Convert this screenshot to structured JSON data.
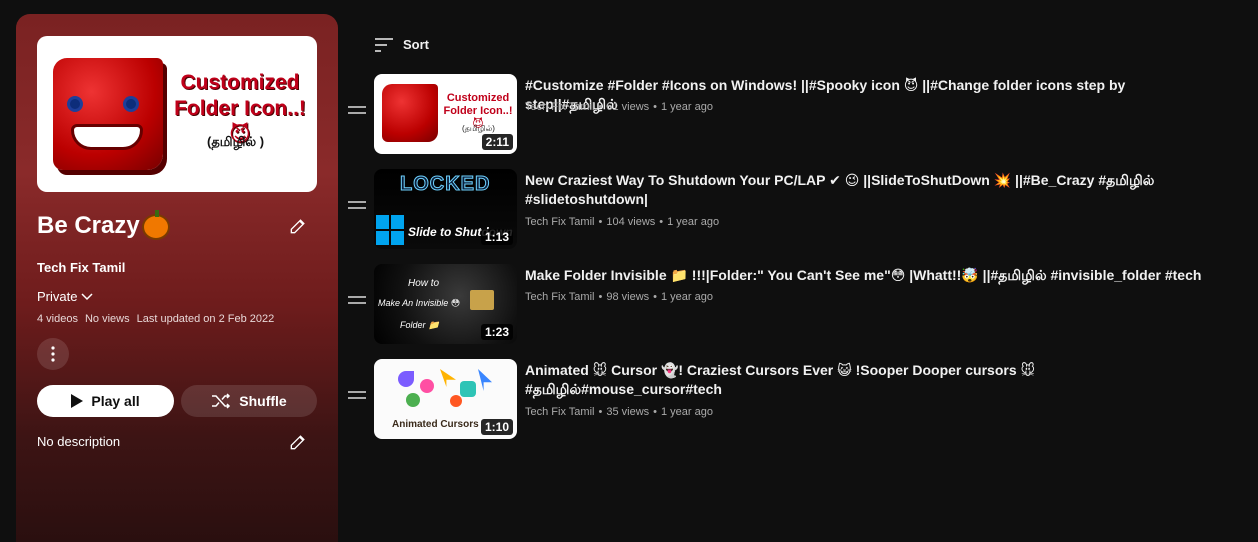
{
  "playlist": {
    "thumb_line1": "Customized",
    "thumb_line2": "Folder Icon..!😈",
    "thumb_line3": "(தமிழில் )",
    "title": "Be Crazy",
    "channel": "Tech Fix Tamil",
    "privacy": "Private",
    "video_count": "4 videos",
    "views": "No views",
    "updated": "Last updated on 2 Feb 2022",
    "play_all": "Play all",
    "shuffle": "Shuffle",
    "description": "No description"
  },
  "sort_label": "Sort",
  "videos": [
    {
      "title": "#Customize #Folder #Icons on Windows! ||#Spooky icon 😈 ||#Change folder icons step by step||#தமிழில்",
      "channel": "Tech Fix Tamil",
      "views": "61 views",
      "age": "1 year ago",
      "duration": "2:11",
      "thumb_text1": "Customized",
      "thumb_text2": "Folder Icon..!😈",
      "thumb_text3": "(தமிழில்)"
    },
    {
      "title": "New Craziest Way To Shutdown Your PC/LAP ✔ 😉 ||SlideToShutDown 💥 ||#Be_Crazy #தமிழில் #slidetoshutdown|",
      "channel": "Tech Fix Tamil",
      "views": "104 views",
      "age": "1 year ago",
      "duration": "1:13",
      "thumb_text1": "LOCKED",
      "thumb_text2": "Slide to Shutdown"
    },
    {
      "title": "Make Folder Invisible 📁 !!!|Folder:\" You Can't See me\"😳 |Whatt!!🤯 ||#தமிழில் #invisible_folder #tech",
      "channel": "Tech Fix Tamil",
      "views": "98 views",
      "age": "1 year ago",
      "duration": "1:23",
      "thumb_text1": "How to",
      "thumb_text2": "Make An Invisible 😳",
      "thumb_text3": "Folder 📁"
    },
    {
      "title": "Animated 🐭 Cursor 👻! Craziest Cursors Ever 😺 !Sooper Dooper cursors 🐭 #தமிழில்#mouse_cursor#tech",
      "channel": "Tech Fix Tamil",
      "views": "35 views",
      "age": "1 year ago",
      "duration": "1:10",
      "thumb_text1": "Animated Cursors"
    }
  ],
  "colors": {
    "panel_top": "#7a2222",
    "panel_bottom": "#2a0f0f",
    "background": "#0f0f0f",
    "meta_text": "#aaaaaa"
  }
}
